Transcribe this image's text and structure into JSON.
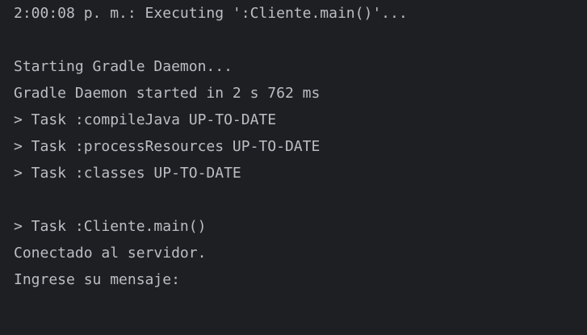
{
  "console": {
    "lines": [
      "2:00:08 p. m.: Executing ':Cliente.main()'...",
      "",
      "Starting Gradle Daemon...",
      "Gradle Daemon started in 2 s 762 ms",
      "> Task :compileJava UP-TO-DATE",
      "> Task :processResources UP-TO-DATE",
      "> Task :classes UP-TO-DATE",
      "",
      "> Task :Cliente.main()",
      "Conectado al servidor.",
      "Ingrese su mensaje:"
    ]
  },
  "colors": {
    "background": "#1e1f22",
    "text": "#bcbec4"
  }
}
